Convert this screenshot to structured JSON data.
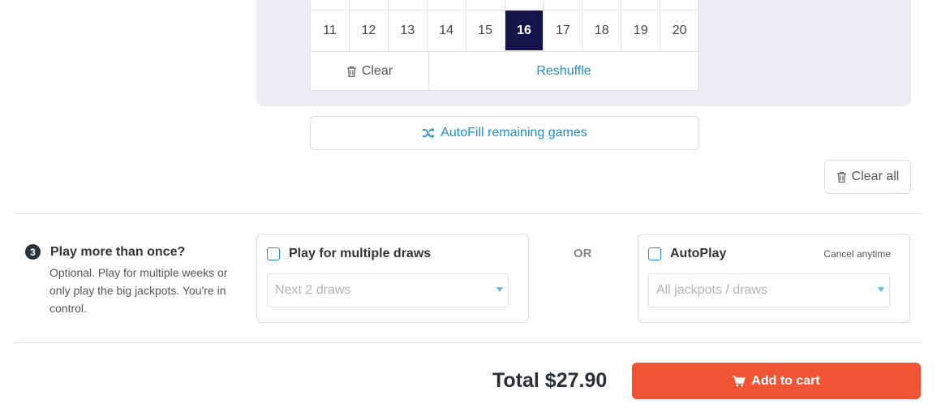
{
  "number_grid": {
    "top_row": [
      "",
      "",
      "",
      "",
      "",
      "",
      "",
      "",
      "",
      ""
    ],
    "numbers": [
      "11",
      "12",
      "13",
      "14",
      "15",
      "16",
      "17",
      "18",
      "19",
      "20"
    ],
    "selected": "16",
    "clear_label": "Clear",
    "reshuffle_label": "Reshuffle"
  },
  "autofill_label": "AutoFill remaining games",
  "clear_all_label": "Clear all",
  "step": {
    "number": "3",
    "title": "Play more than once?",
    "description": "Optional. Play for multiple weeks or only play the big jackpots. You're in control."
  },
  "multi_draw": {
    "label": "Play for multiple draws",
    "select_value": "Next 2 draws"
  },
  "or_label": "OR",
  "autoplay": {
    "label": "AutoPlay",
    "note": "Cancel anytime",
    "select_value": "All jackpots / draws"
  },
  "total_label": "Total $27.90",
  "add_to_cart_label": "Add to cart",
  "colors": {
    "accent": "#1a8fd8",
    "selected_number": "#15134a",
    "cart_button": "#f05432"
  },
  "icons": {
    "clear": "trash-icon",
    "autofill": "shuffle-icon",
    "clear_all": "trash-icon",
    "cart": "cart-icon",
    "dropdown": "caret-down-icon"
  }
}
